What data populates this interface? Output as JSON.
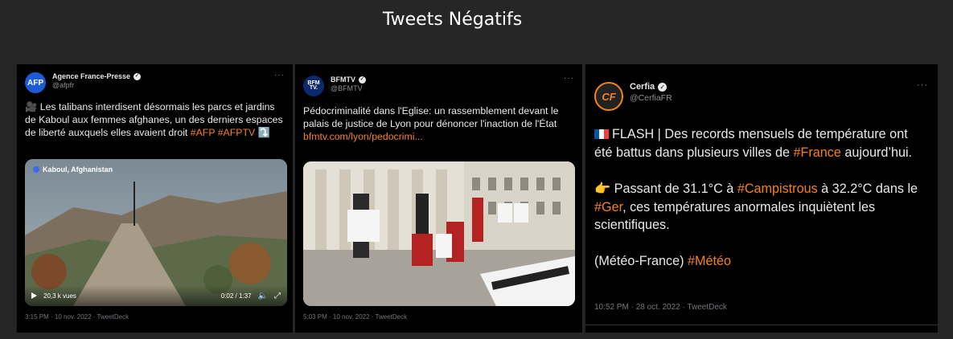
{
  "page": {
    "title": "Tweets Négatifs"
  },
  "tweets": [
    {
      "avatar": "AFP",
      "account": "Agence France-Presse",
      "handle": "@afpfr",
      "text_main": "🎥 Les talibans interdisent désormais les parcs et jardins de Kaboul aux femmes afghanes, un des derniers espaces de liberté auxquels elles avaient droit",
      "hashtags": "#AFP #AFPTV",
      "arrow": "⤵️",
      "media": {
        "location": "Kaboul, Afghanistan",
        "views": "20,3 k vues",
        "time": "0:02 / 1:37"
      },
      "meta": "3:15 PM · 10 nov. 2022 · TweetDeck"
    },
    {
      "avatar": "BFM TV.",
      "account": "BFMTV",
      "handle": "@BFMTV",
      "text_main": "Pédocriminalité dans l'Eglise: un rassemblement devant le palais de justice de Lyon pour dénoncer l'inaction de l'État",
      "link": "bfmtv.com/lyon/pedocrimi...",
      "meta": "5:03 PM · 10 nov. 2022 · TweetDeck"
    },
    {
      "avatar": "CF",
      "account": "Cerfia",
      "handle": "@CerfiaFR",
      "p1_main": "FLASH | Des records mensuels de température ont été battus dans plusieurs villes de ",
      "p1_tag": "#France",
      "p1_end": " aujourd’hui.",
      "p2_a": "👉 Passant de 31.1°C à ",
      "p2_tag1": "#Campistrous",
      "p2_b": " à 32.2°C dans le ",
      "p2_tag2": "#Ger",
      "p2_c": ", ces températures anormales inquiètent les scientifiques.",
      "p3_a": "(Météo-France) ",
      "p3_tag": "#Météo",
      "meta": "10:52 PM · 28 oct. 2022 · TweetDeck"
    }
  ],
  "ui": {
    "more": "···",
    "verified": "✓"
  },
  "colors": {
    "accent": "#f58220",
    "card": "#000000",
    "background": "#262626"
  }
}
